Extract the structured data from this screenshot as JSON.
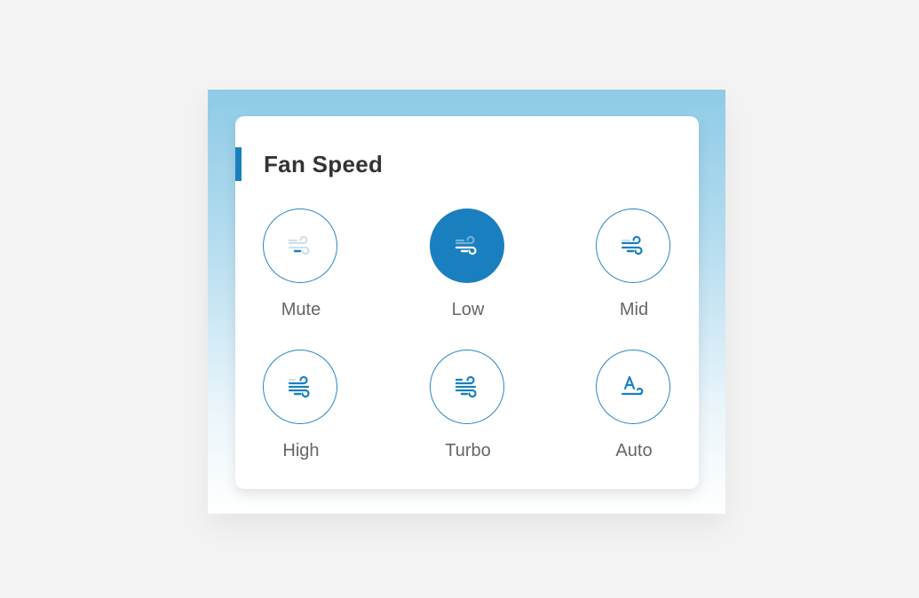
{
  "panel": {
    "title": "Fan Speed",
    "accent_color": "#1a7fbf",
    "options": [
      {
        "label": "Mute",
        "icon": "fan-speed-mute-icon",
        "selected": false
      },
      {
        "label": "Low",
        "icon": "fan-speed-low-icon",
        "selected": true
      },
      {
        "label": "Mid",
        "icon": "fan-speed-mid-icon",
        "selected": false
      },
      {
        "label": "High",
        "icon": "fan-speed-high-icon",
        "selected": false
      },
      {
        "label": "Turbo",
        "icon": "fan-speed-turbo-icon",
        "selected": false
      },
      {
        "label": "Auto",
        "icon": "fan-speed-auto-icon",
        "selected": false
      }
    ]
  }
}
